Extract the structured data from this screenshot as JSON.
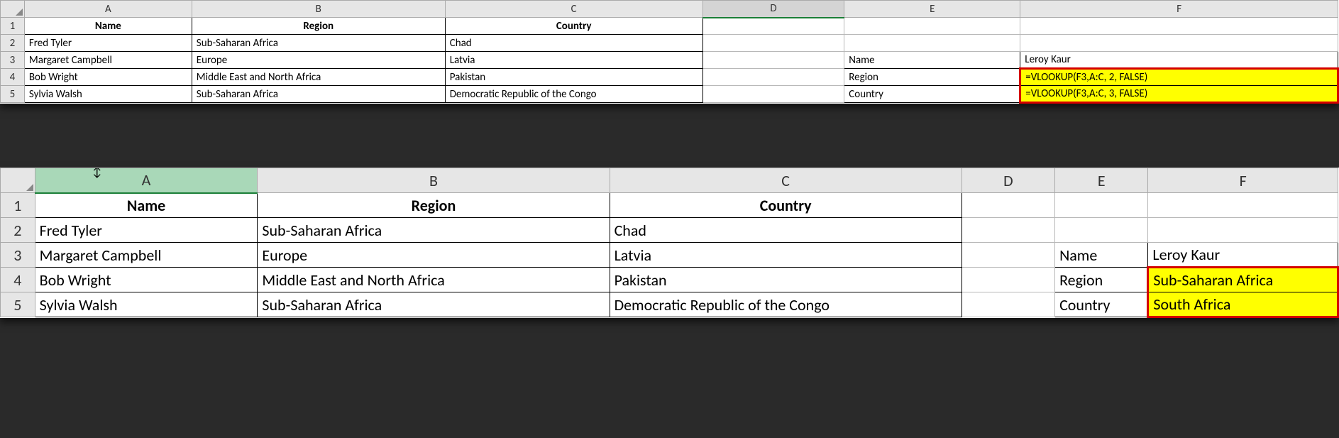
{
  "columns": [
    "A",
    "B",
    "C",
    "D",
    "E",
    "F"
  ],
  "row_numbers": [
    "1",
    "2",
    "3",
    "4",
    "5"
  ],
  "sheet1": {
    "headers": {
      "A": "Name",
      "B": "Region",
      "C": "Country"
    },
    "rows": [
      {
        "A": "Fred Tyler",
        "B": "Sub-Saharan Africa",
        "C": "Chad"
      },
      {
        "A": "Margaret Campbell",
        "B": "Europe",
        "C": "Latvia"
      },
      {
        "A": "Bob Wright",
        "B": "Middle East and North Africa",
        "C": "Pakistan"
      },
      {
        "A": "Sylvia Walsh",
        "B": "Sub-Saharan Africa",
        "C": "Democratic Republic of the Congo"
      }
    ],
    "lookup": {
      "name_label": "Name",
      "name_value": "Leroy Kaur",
      "region_label": "Region",
      "region_formula": "=VLOOKUP(F3,A:C, 2, FALSE)",
      "country_label": "Country",
      "country_formula": "=VLOOKUP(F3,A:C, 3, FALSE)"
    }
  },
  "sheet2": {
    "headers": {
      "A": "Name",
      "B": "Region",
      "C": "Country"
    },
    "rows": [
      {
        "A": "Fred Tyler",
        "B": "Sub-Saharan Africa",
        "C": "Chad"
      },
      {
        "A": "Margaret Campbell",
        "B": "Europe",
        "C": "Latvia"
      },
      {
        "A": "Bob Wright",
        "B": "Middle East and North Africa",
        "C": "Pakistan"
      },
      {
        "A": "Sylvia Walsh",
        "B": "Sub-Saharan Africa",
        "C": "Democratic Republic of the Congo"
      }
    ],
    "lookup": {
      "name_label": "Name",
      "name_value": "Leroy Kaur",
      "region_label": "Region",
      "region_value": "Sub-Saharan Africa",
      "country_label": "Country",
      "country_value": "South Africa"
    }
  }
}
